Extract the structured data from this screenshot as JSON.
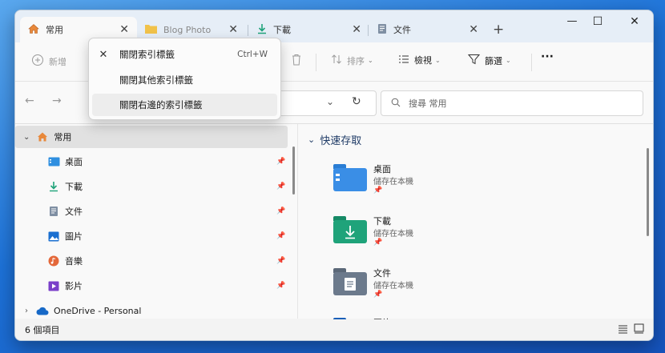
{
  "tabs": [
    {
      "label": "常用",
      "close": "✕"
    },
    {
      "label": "Blog Photo",
      "close": "✕"
    },
    {
      "label": "下載",
      "close": "✕"
    },
    {
      "label": "文件",
      "close": "✕"
    }
  ],
  "new_tab": "+",
  "window_controls": {
    "minimize": "—",
    "maximize": "☐",
    "close": "✕"
  },
  "toolbar": {
    "new_label": "新增",
    "sort_label": "排序",
    "view_label": "檢視",
    "filter_label": "篩選",
    "more": "···"
  },
  "nav": {
    "back": "←",
    "forward": "→",
    "address_chevron": "⌄",
    "refresh": "↻",
    "search_placeholder": "搜尋 常用"
  },
  "context_menu": {
    "items": [
      {
        "label": "關閉索引標籤",
        "shortcut": "Ctrl+W",
        "icon": "✕"
      },
      {
        "label": "關閉其他索引標籤",
        "shortcut": "",
        "icon": ""
      },
      {
        "label": "關閉右邊的索引標籤",
        "shortcut": "",
        "icon": ""
      }
    ]
  },
  "sidebar": {
    "home": "常用",
    "items": [
      {
        "label": "桌面"
      },
      {
        "label": "下載"
      },
      {
        "label": "文件"
      },
      {
        "label": "圖片"
      },
      {
        "label": "音樂"
      },
      {
        "label": "影片"
      }
    ],
    "onedrive": "OneDrive - Personal",
    "pin": "📌"
  },
  "quick_access": {
    "header": "快速存取",
    "items": [
      {
        "name": "桌面",
        "sub": "儲存在本機"
      },
      {
        "name": "下載",
        "sub": "儲存在本機"
      },
      {
        "name": "文件",
        "sub": "儲存在本機"
      },
      {
        "name": "圖片",
        "sub": ""
      }
    ]
  },
  "status": {
    "count": "6 個項目"
  },
  "colors": {
    "accent": "#1a73e8",
    "folder_blue": "#3a8ee6",
    "folder_green": "#1fa37a",
    "folder_gray": "#6c7a8c"
  }
}
